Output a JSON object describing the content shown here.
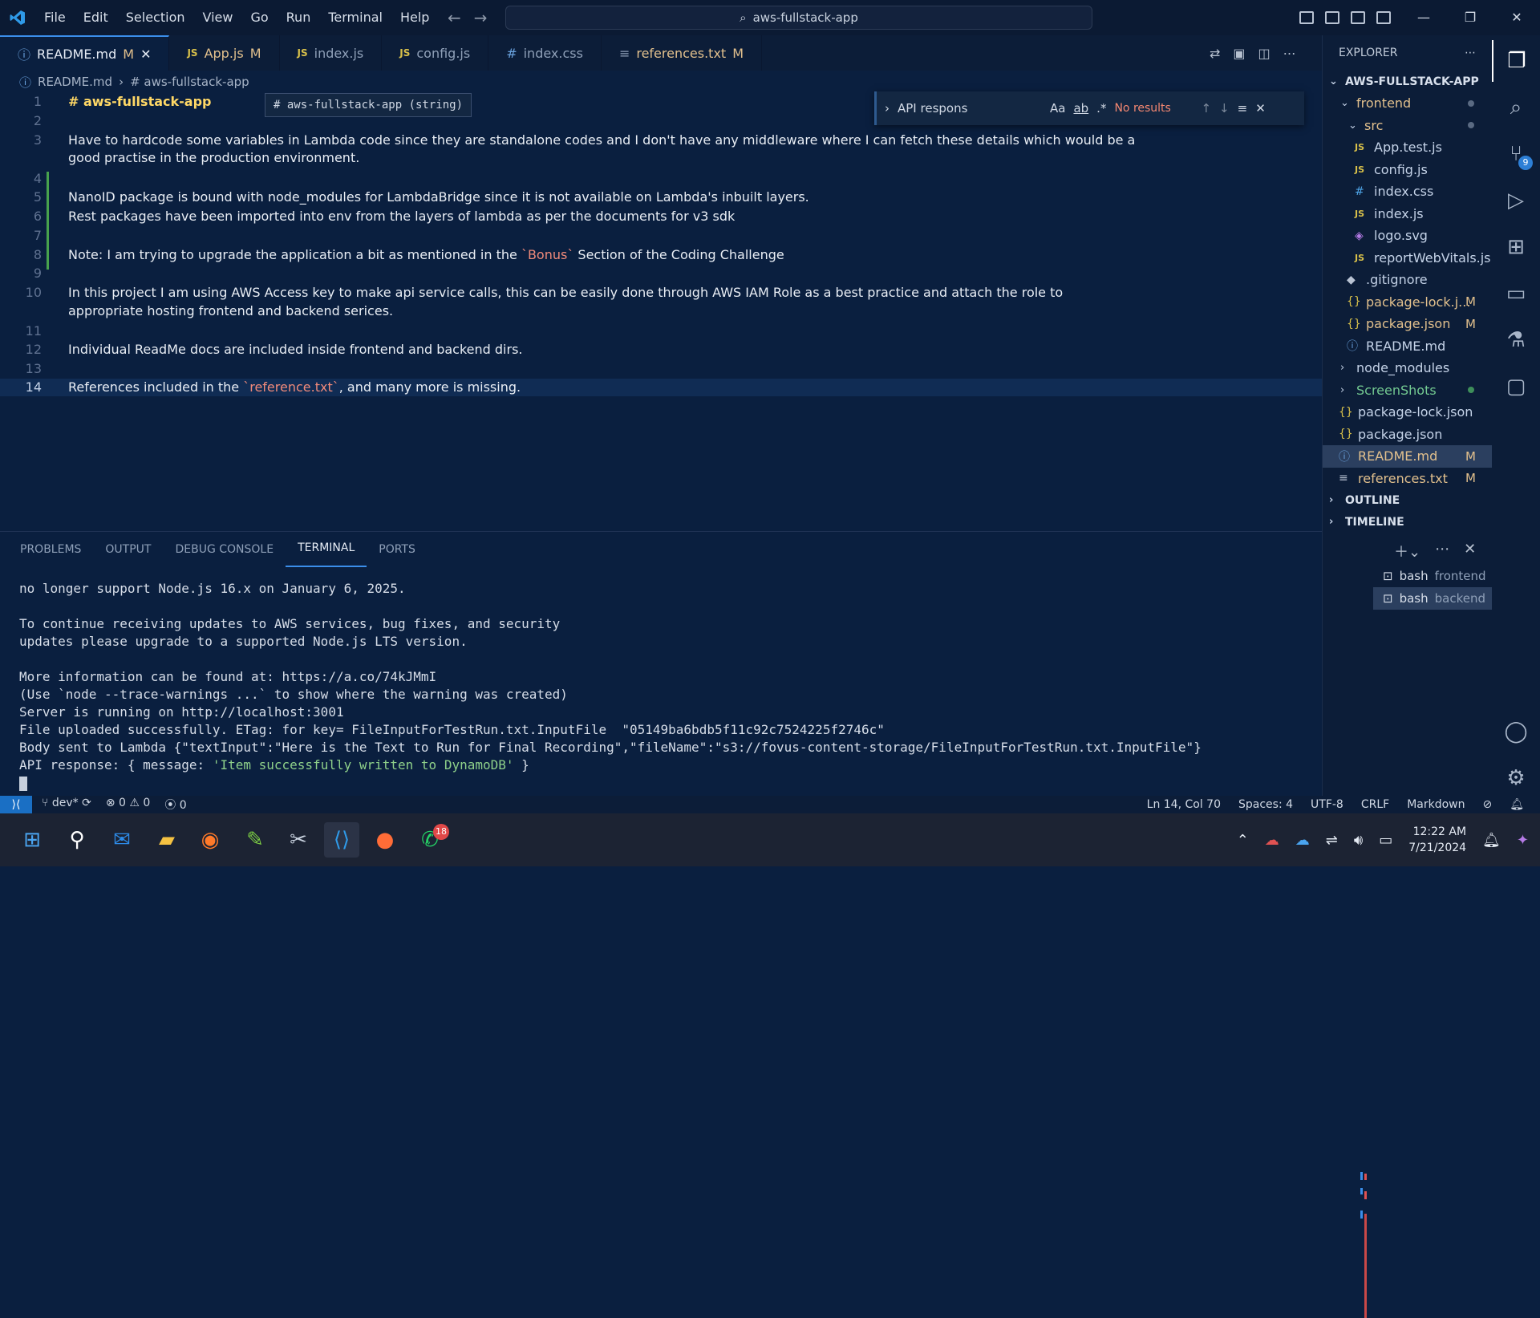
{
  "titlebar": {
    "menu": [
      "File",
      "Edit",
      "Selection",
      "View",
      "Go",
      "Run",
      "Terminal",
      "Help"
    ],
    "command_center": "aws-fullstack-app"
  },
  "tabs": [
    {
      "label": "README.md",
      "mark": "M",
      "icon": "info-icon",
      "active": true
    },
    {
      "label": "App.js",
      "mark": "M",
      "icon": "js-icon"
    },
    {
      "label": "index.js",
      "mark": "",
      "icon": "js-icon"
    },
    {
      "label": "config.js",
      "mark": "",
      "icon": "js-icon"
    },
    {
      "label": "index.css",
      "mark": "",
      "icon": "css-icon"
    },
    {
      "label": "references.txt",
      "mark": "M",
      "icon": "text-icon"
    }
  ],
  "breadcrumb": {
    "file": "README.md",
    "symbol": "# aws-fullstack-app"
  },
  "hover_tooltip": "# aws-fullstack-app (string)",
  "find_widget": {
    "query": "API respons",
    "result": "No results",
    "opt_case": "Aa",
    "opt_word": "ab",
    "opt_regex": ".*"
  },
  "editor": {
    "lines": [
      {
        "n": "1",
        "text": "# aws-fullstack-app"
      },
      {
        "n": "2",
        "text": ""
      },
      {
        "n": "3",
        "text": "Have to hardcode some variables in Lambda code since they are standalone codes and I don't have any middleware where I can fetch these details which would be a"
      },
      {
        "n": "",
        "text": "good practise in the production environment."
      },
      {
        "n": "4",
        "text": ""
      },
      {
        "n": "5",
        "text": "NanoID package is bound with node_modules for LambdaBridge since it is not available on Lambda's inbuilt layers."
      },
      {
        "n": "6",
        "text": "Rest packages have been imported into env from the layers of lambda as per the documents for v3 sdk"
      },
      {
        "n": "7",
        "text": ""
      },
      {
        "n": "8",
        "text_a": "Note: I am trying to upgrade the application a bit as mentioned in the ",
        "text_b": "`Bonus`",
        "text_c": " Section of the Coding Challenge"
      },
      {
        "n": "9",
        "text": ""
      },
      {
        "n": "10",
        "text": "In this project I am using AWS Access key to make api service calls, this can be easily done through AWS IAM Role as a best practice and attach the role to"
      },
      {
        "n": "",
        "text": "appropriate hosting frontend and backend serices."
      },
      {
        "n": "11",
        "text": ""
      },
      {
        "n": "12",
        "text": "Individual ReadMe docs are included inside frontend and backend dirs."
      },
      {
        "n": "13",
        "text": ""
      },
      {
        "n": "14",
        "text_a": "References included in the ",
        "text_b": "`reference.txt`",
        "text_c": ", and many more is missing."
      }
    ]
  },
  "explorer": {
    "title": "EXPLORER",
    "root": "AWS-FULLSTACK-APP",
    "items": [
      {
        "label": "frontend",
        "type": "folder-open",
        "depth": 1
      },
      {
        "label": "src",
        "type": "folder-open",
        "depth": 2
      },
      {
        "label": "App.test.js",
        "type": "js",
        "depth": 3
      },
      {
        "label": "config.js",
        "type": "js",
        "depth": 3
      },
      {
        "label": "index.css",
        "type": "css",
        "depth": 3
      },
      {
        "label": "index.js",
        "type": "js",
        "depth": 3
      },
      {
        "label": "logo.svg",
        "type": "svg",
        "depth": 3
      },
      {
        "label": "reportWebVitals.js",
        "type": "js",
        "depth": 3
      },
      {
        "label": ".gitignore",
        "type": "git",
        "depth": 2
      },
      {
        "label": "package-lock.j...",
        "type": "json",
        "depth": 2,
        "mark": "M"
      },
      {
        "label": "package.json",
        "type": "json",
        "depth": 2,
        "mark": "M"
      },
      {
        "label": "README.md",
        "type": "info",
        "depth": 2
      },
      {
        "label": "node_modules",
        "type": "folder",
        "depth": 1
      },
      {
        "label": "ScreenShots",
        "type": "folder",
        "depth": 1
      },
      {
        "label": "package-lock.json",
        "type": "json",
        "depth": 1
      },
      {
        "label": "package.json",
        "type": "json",
        "depth": 1
      },
      {
        "label": "README.md",
        "type": "info",
        "depth": 1,
        "mark": "M",
        "selected": true
      },
      {
        "label": "references.txt",
        "type": "txt",
        "depth": 1,
        "mark": "M"
      }
    ],
    "sections": [
      "OUTLINE",
      "TIMELINE"
    ]
  },
  "activity_badge": "9",
  "panel": {
    "tabs": [
      "PROBLEMS",
      "OUTPUT",
      "DEBUG CONSOLE",
      "TERMINAL",
      "PORTS"
    ],
    "active_tab": "TERMINAL",
    "terminal_lines": [
      "no longer support Node.js 16.x on January 6, 2025.",
      "",
      "To continue receiving updates to AWS services, bug fixes, and security",
      "updates please upgrade to a supported Node.js LTS version.",
      "",
      "More information can be found at: https://a.co/74kJMmI",
      "(Use `node --trace-warnings ...` to show where the warning was created)",
      "Server is running on http://localhost:3001",
      "File uploaded successfully. ETag: for key= FileInputForTestRun.txt.InputFile  \"05149ba6bdb5f11c92c7524225f2746c\"",
      "Body sent to Lambda {\"textInput\":\"Here is the Text to Run for Final Recording\",\"fileName\":\"s3://fovus-content-storage/FileInputForTestRun.txt.InputFile\"}"
    ],
    "api_line_a": "API response: { message: ",
    "api_line_b": "'Item successfully written to DynamoDB'",
    "api_line_c": " }",
    "terminals": [
      {
        "shell": "bash",
        "name": "frontend"
      },
      {
        "shell": "bash",
        "name": "backend",
        "selected": true
      }
    ]
  },
  "statusbar": {
    "branch": "dev*",
    "errors": "0",
    "warnings": "0",
    "ports": "0",
    "position": "Ln 14, Col 70",
    "spaces": "Spaces: 4",
    "encoding": "UTF-8",
    "eol": "CRLF",
    "language": "Markdown"
  },
  "taskbar": {
    "time": "12:22 AM",
    "date": "7/21/2024",
    "whatsapp_badge": "18"
  },
  "colors": {
    "accent": "#3b8eea",
    "modified": "#e2c08d",
    "editor_bg": "#0a1f3f"
  }
}
